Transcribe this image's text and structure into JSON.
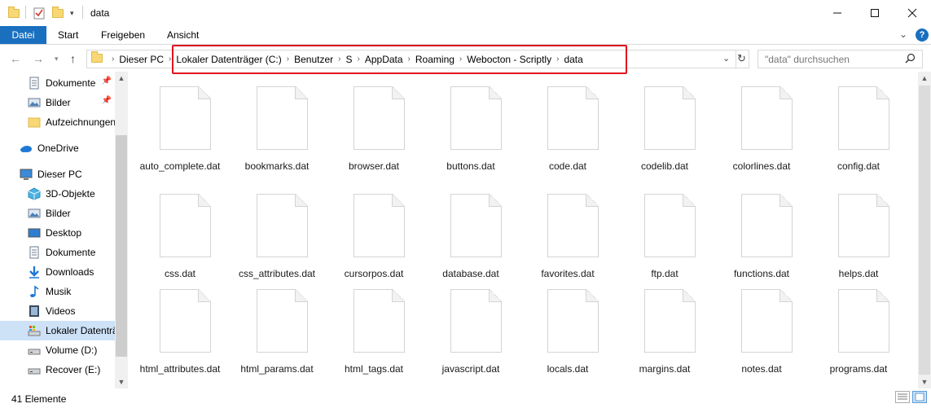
{
  "window": {
    "title": "data",
    "minimize_icon": "minimize-icon",
    "maximize_icon": "maximize-icon",
    "close_icon": "close-icon"
  },
  "ribbon": {
    "tabs": [
      {
        "label": "Datei"
      },
      {
        "label": "Start"
      },
      {
        "label": "Freigeben"
      },
      {
        "label": "Ansicht"
      }
    ],
    "file_tab_color": "#1a6fbf"
  },
  "nav": {
    "breadcrumbs": [
      "Dieser PC",
      "Lokaler Datenträger (C:)",
      "Benutzer",
      "S",
      "AppData",
      "Roaming",
      "Webocton - Scriptly",
      "data"
    ],
    "search_placeholder": "\"data\" durchsuchen",
    "highlight_color": "#e0141e"
  },
  "sidebar": {
    "items": [
      {
        "label": "Dokumente",
        "icon": "documents-icon",
        "pinned": true
      },
      {
        "label": "Bilder",
        "icon": "pictures-icon",
        "pinned": true
      },
      {
        "label": "Aufzeichnungen",
        "icon": "folder-icon",
        "pinned": false
      },
      {
        "label": "OneDrive",
        "icon": "onedrive-icon",
        "pinned": false
      },
      {
        "label": "Dieser PC",
        "icon": "computer-icon",
        "pinned": false
      },
      {
        "label": "3D-Objekte",
        "icon": "3d-objects-icon",
        "pinned": false
      },
      {
        "label": "Bilder",
        "icon": "pictures-icon",
        "pinned": false
      },
      {
        "label": "Desktop",
        "icon": "desktop-icon",
        "pinned": false
      },
      {
        "label": "Dokumente",
        "icon": "documents-icon",
        "pinned": false
      },
      {
        "label": "Downloads",
        "icon": "downloads-icon",
        "pinned": false
      },
      {
        "label": "Musik",
        "icon": "music-icon",
        "pinned": false
      },
      {
        "label": "Videos",
        "icon": "videos-icon",
        "pinned": false
      },
      {
        "label": "Lokaler Datenträ",
        "icon": "drive-icon",
        "pinned": false,
        "selected": true
      },
      {
        "label": "Volume (D:)",
        "icon": "drive-icon",
        "pinned": false
      },
      {
        "label": "Recover (E:)",
        "icon": "drive-icon",
        "pinned": false
      }
    ]
  },
  "files": [
    "auto_complete.dat",
    "bookmarks.dat",
    "browser.dat",
    "buttons.dat",
    "code.dat",
    "codelib.dat",
    "colorlines.dat",
    "config.dat",
    "css.dat",
    "css_attributes.dat",
    "cursorpos.dat",
    "database.dat",
    "favorites.dat",
    "ftp.dat",
    "functions.dat",
    "helps.dat",
    "html_attributes.dat",
    "html_params.dat",
    "html_tags.dat",
    "javascript.dat",
    "locals.dat",
    "margins.dat",
    "notes.dat",
    "programs.dat"
  ],
  "status": {
    "item_count": "41 Elemente"
  }
}
